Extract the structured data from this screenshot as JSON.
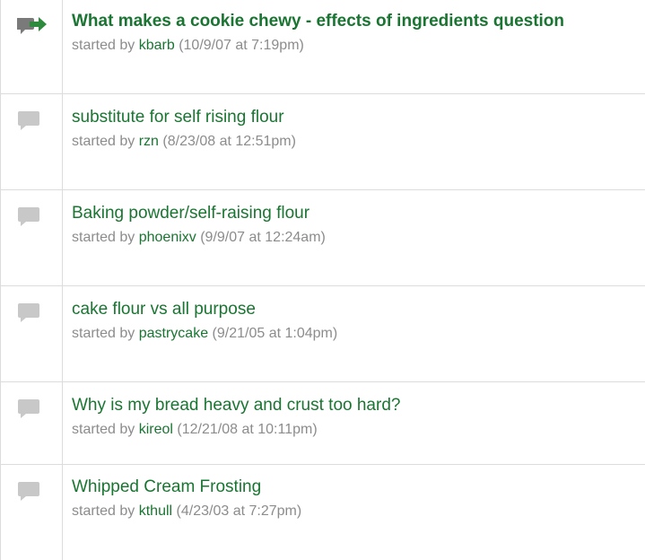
{
  "threads": [
    {
      "title": "What makes a cookie chewy - effects of ingredients question",
      "started_by_label": "started by",
      "user": "kbarb",
      "date": "(10/9/07 at 7:19pm)",
      "icon": "reply-arrow-icon",
      "bold": true
    },
    {
      "title": "substitute for self rising flour",
      "started_by_label": "started by",
      "user": "rzn",
      "date": "(8/23/08 at 12:51pm)",
      "icon": "speech-bubble-icon"
    },
    {
      "title": "Baking powder/self-raising flour",
      "started_by_label": "started by",
      "user": "phoenixv",
      "date": "(9/9/07 at 12:24am)",
      "icon": "speech-bubble-icon"
    },
    {
      "title": "cake flour vs all purpose",
      "started_by_label": "started by",
      "user": "pastrycake",
      "date": "(9/21/05 at 1:04pm)",
      "icon": "speech-bubble-icon"
    },
    {
      "title": "Why is my bread heavy and crust too hard?",
      "started_by_label": "started by",
      "user": "kireol",
      "date": "(12/21/08 at 10:11pm)",
      "icon": "speech-bubble-icon"
    },
    {
      "title": "Whipped Cream Frosting",
      "started_by_label": "started by",
      "user": "kthull",
      "date": "(4/23/03 at 7:27pm)",
      "icon": "speech-bubble-icon"
    }
  ],
  "colors": {
    "link": "#1a7532",
    "meta": "#8c8c8c",
    "icon_gray": "#c8c8c8",
    "icon_dark": "#7a7a7a",
    "icon_green": "#2e8b3e",
    "divider": "#dcdcdc"
  }
}
